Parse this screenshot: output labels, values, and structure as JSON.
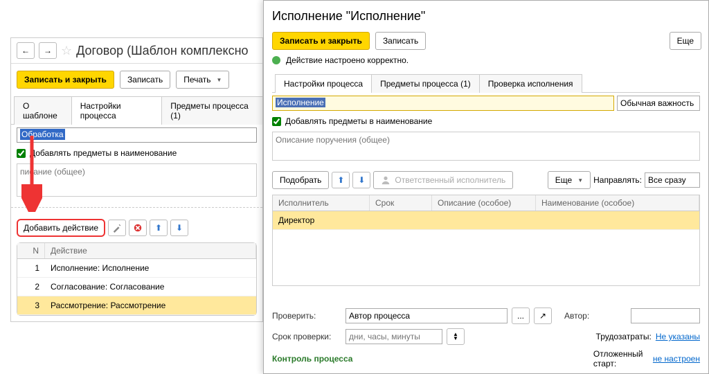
{
  "left": {
    "title": "Договор (Шаблон комплексно",
    "save_close": "Записать и закрыть",
    "save": "Записать",
    "print": "Печать",
    "tabs": [
      "О шаблоне",
      "Настройки процесса",
      "Предметы процесса (1)"
    ],
    "name_value": "Обработка",
    "add_subjects": "Добавлять предметы в наименование",
    "desc_placeholder": "писание (общее)",
    "add_action": "Добавить действие",
    "grid": {
      "cols": [
        "N",
        "Действие"
      ],
      "rows": [
        {
          "n": "1",
          "act": "Исполнение: Исполнение"
        },
        {
          "n": "2",
          "act": "Согласование: Согласование"
        },
        {
          "n": "3",
          "act": "Рассмотрение: Рассмотрение"
        }
      ]
    }
  },
  "right": {
    "title": "Исполнение \"Исполнение\"",
    "save_close": "Записать и закрыть",
    "save": "Записать",
    "more": "Еще",
    "status": "Действие настроено корректно.",
    "tabs": [
      "Настройки процесса",
      "Предметы процесса (1)",
      "Проверка исполнения"
    ],
    "name_value": "Исполнение",
    "importance": "Обычная важность",
    "add_subjects": "Добавлять предметы в наименование",
    "desc_placeholder": "Описание поручения (общее)",
    "pick": "Подобрать",
    "responsible": "Ответственный исполнитель",
    "more2": "Еще",
    "direct_lbl": "Направлять:",
    "direct_val": "Все сразу",
    "exec_cols": [
      "Исполнитель",
      "Срок",
      "Описание (особое)",
      "Наименование (особое)"
    ],
    "exec_rows": [
      {
        "p": "Директор"
      }
    ],
    "check_lbl": "Проверить:",
    "check_val": "Автор процесса",
    "author_lbl": "Автор:",
    "deadline_lbl": "Срок проверки:",
    "deadline_ph": "дни, часы, минуты",
    "labor_lbl": "Трудозатраты:",
    "labor_val": "Не указаны",
    "delayed_lbl": "Отложенный старт:",
    "delayed_val": "не настроен",
    "control_hdr": "Контроль процесса"
  }
}
